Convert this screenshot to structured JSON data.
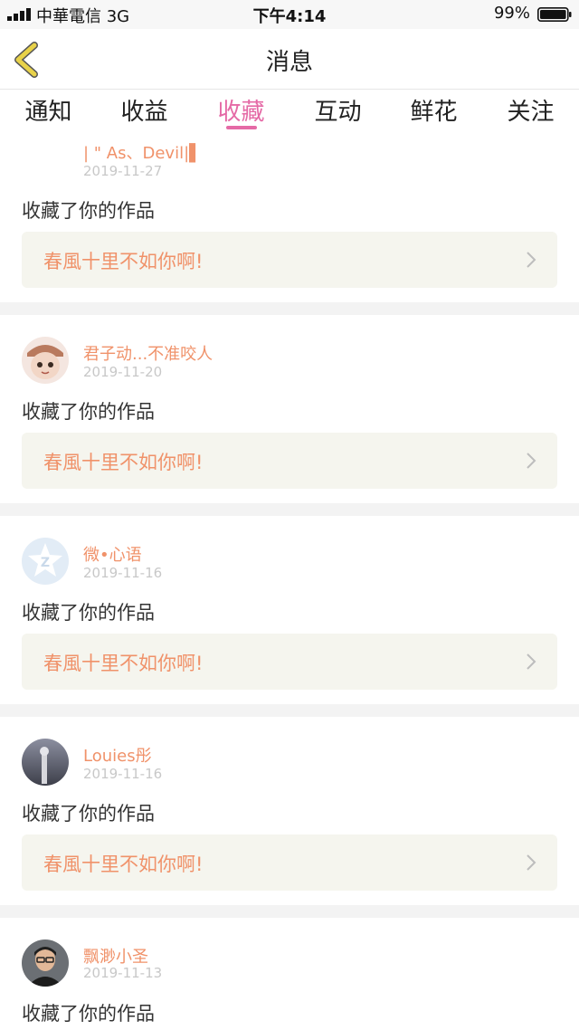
{
  "status_bar": {
    "carrier": "中華電信  3G",
    "time": "下午4:14",
    "battery": "99%"
  },
  "nav": {
    "title": "消息"
  },
  "tabs": [
    {
      "label": "通知"
    },
    {
      "label": "收益"
    },
    {
      "label": "收藏",
      "active": true
    },
    {
      "label": "互动"
    },
    {
      "label": "鲜花"
    },
    {
      "label": "关注"
    }
  ],
  "items": [
    {
      "user": "| \" As、Devil|▌",
      "date": "2019-11-27",
      "action": "收藏了你的作品",
      "work": "春風十里不如你啊!"
    },
    {
      "user": "君子动...不准咬人",
      "date": "2019-11-20",
      "action": "收藏了你的作品",
      "work": "春風十里不如你啊!"
    },
    {
      "user": "微•心语",
      "date": "2019-11-16",
      "action": "收藏了你的作品",
      "work": "春風十里不如你啊!"
    },
    {
      "user": "Louies彤",
      "date": "2019-11-16",
      "action": "收藏了你的作品",
      "work": "春風十里不如你啊!"
    },
    {
      "user": "飘渺小圣",
      "date": "2019-11-13",
      "action": "收藏了你的作品"
    }
  ],
  "colors": {
    "accent": "#e56aa6",
    "name": "#f0926a",
    "back_icon": "#e8d24a"
  },
  "icons": [
    "signal-icon",
    "battery-icon",
    "back-arrow-icon",
    "chevron-right-icon"
  ]
}
